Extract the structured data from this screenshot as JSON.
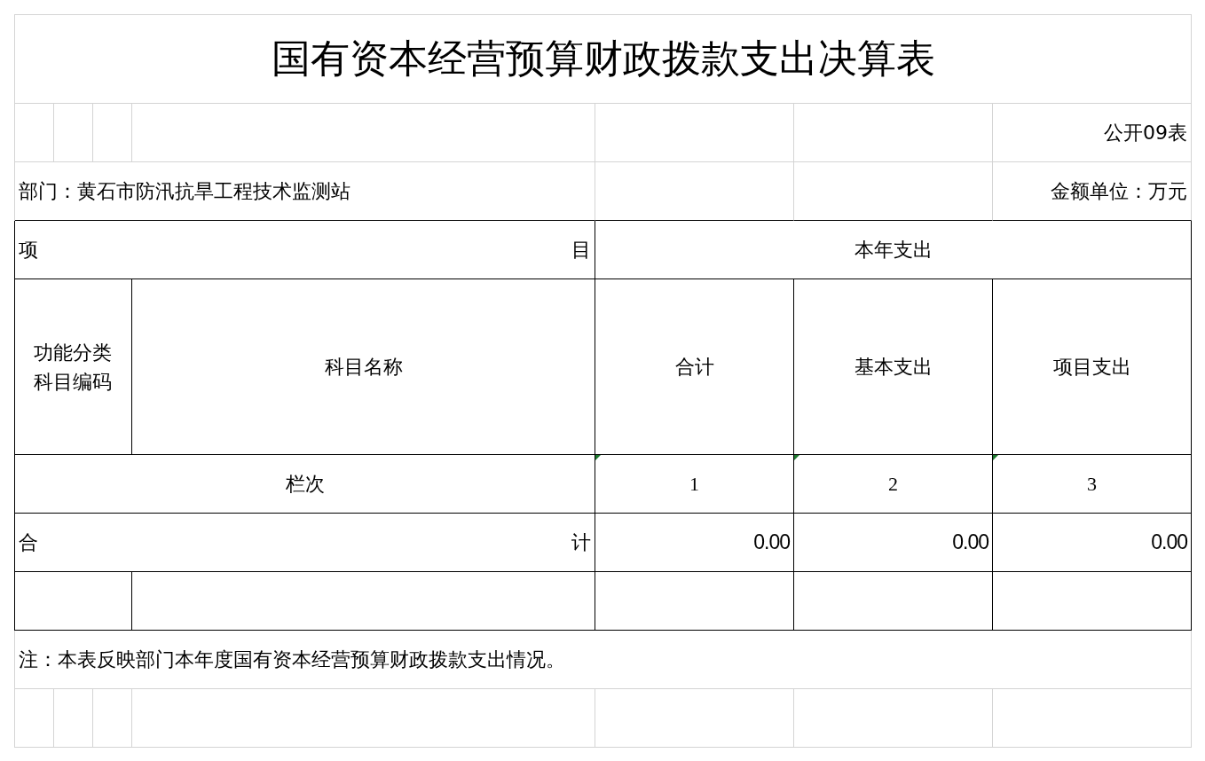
{
  "title": "国有资本经营预算财政拨款支出决算表",
  "table_code": "公开09表",
  "department": "部门：黄石市防汛抗旱工程技术监测站",
  "unit": "金额单位：万元",
  "header": {
    "item_left": "项",
    "item_right": "目",
    "year_expense": "本年支出",
    "code": "功能分类科目编码",
    "name": "科目名称",
    "columns": [
      "合计",
      "基本支出",
      "项目支出"
    ]
  },
  "index_row": {
    "label": "栏次",
    "numbers": [
      "1",
      "2",
      "3"
    ]
  },
  "total_row": {
    "label_left": "合",
    "label_right": "计",
    "values": [
      "0.00",
      "0.00",
      "0.00"
    ]
  },
  "note": "注：本表反映部门本年度国有资本经营预算财政拨款支出情况。"
}
